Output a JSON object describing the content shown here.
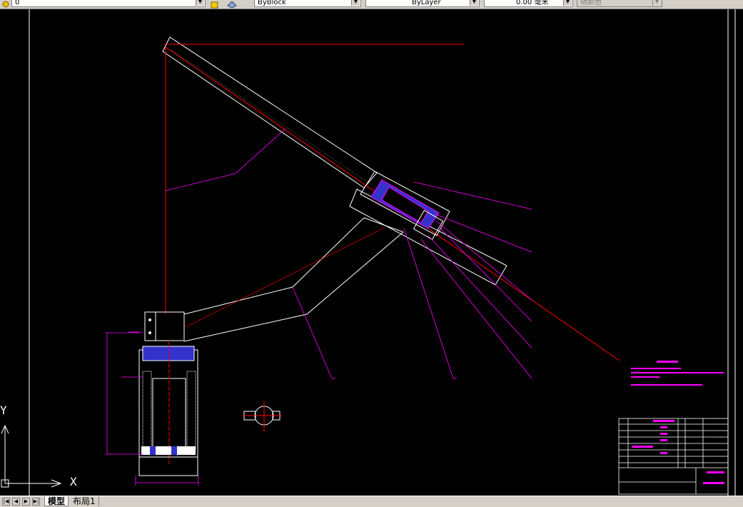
{
  "toolbar": {
    "layer_value": "0",
    "color_value": "ByBlock",
    "linetype_value": "ByLayer",
    "lineweight_value": "0.00 毫米",
    "plotstyle_value": "随颜色"
  },
  "tabs": [
    {
      "label": "模型",
      "active": true
    },
    {
      "label": "布局1",
      "active": false
    }
  ],
  "ucs": {
    "x_label": "X",
    "y_label": "Y"
  },
  "colors": {
    "background": "#000000",
    "drawing_line": "#ffffff",
    "dimension": "#ff00ff",
    "centerline": "#ff0000",
    "part_fill": "#3333cc"
  },
  "icons": [
    "layer-icon",
    "color-icon",
    "nav-first-icon",
    "nav-prev-icon",
    "nav-next-icon",
    "nav-last-icon",
    "ucs-icon"
  ]
}
